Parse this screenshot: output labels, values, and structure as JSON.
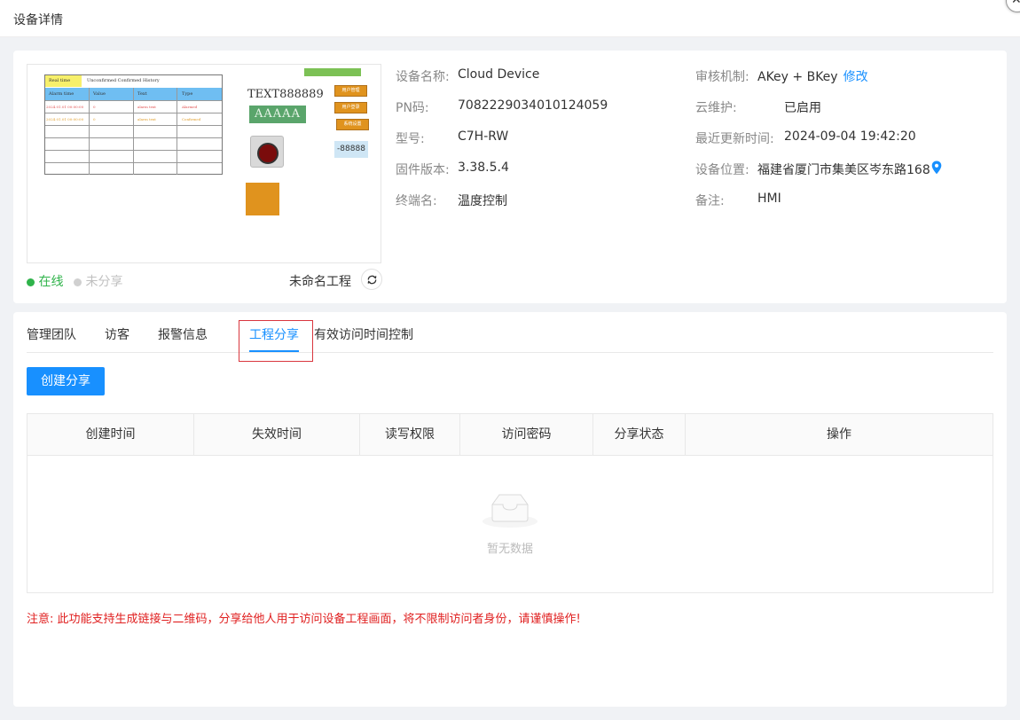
{
  "dialog": {
    "title": "设备详情",
    "close_symbol": "✕"
  },
  "preview": {
    "realtime_label": "Real time",
    "tab_labels": "Unconfirmed  Confirmed  History",
    "table_headers": [
      "Alarm time",
      "Value",
      "Text",
      "Type"
    ],
    "rows": [
      [
        "2024.01.01 00:00:00",
        "0",
        "alarm text",
        "Alarmed"
      ],
      [
        "2024.01.01 00:00:00",
        "0",
        "alarm text",
        "Confirmed"
      ]
    ],
    "text_label": "TEXT888889",
    "aaaaa_label": "AAAAA",
    "orange_buttons": [
      "用户管理",
      "用户登录",
      "系统设置"
    ],
    "number_display": "-88888"
  },
  "status": {
    "online": "在线",
    "unshared": "未分享",
    "project_name": "未命名工程"
  },
  "info_left": [
    {
      "label": "设备名称:",
      "value": "Cloud Device"
    },
    {
      "label": "PN码:",
      "value": "7082229034010124059"
    },
    {
      "label": "型号:",
      "value": "C7H-RW"
    },
    {
      "label": "固件版本:",
      "value": "3.38.5.4"
    },
    {
      "label": "终端名:",
      "value": "温度控制"
    }
  ],
  "info_right": [
    {
      "label": "审核机制:",
      "value": "AKey + BKey",
      "link": "修改"
    },
    {
      "label": "云维护:",
      "value": "已启用"
    },
    {
      "label": "最近更新时间:",
      "value": "2024-09-04 19:42:20"
    },
    {
      "label": "设备位置:",
      "value": "福建省厦门市集美区岑东路168"
    },
    {
      "label": "备注:",
      "value": "HMI"
    }
  ],
  "tabs": [
    "管理团队",
    "访客",
    "报警信息",
    "工程分享",
    "有效访问时间控制"
  ],
  "active_tab": "工程分享",
  "create_button": "创建分享",
  "table": {
    "headers": [
      "创建时间",
      "失效时间",
      "读写权限",
      "访问密码",
      "分享状态",
      "操作"
    ],
    "empty_text": "暂无数据"
  },
  "notice": "注意: 此功能支持生成链接与二维码，分享给他人用于访问设备工程画面，将不限制访问者身份，请谨慎操作!",
  "colors": {
    "primary": "#1890ff",
    "online": "#2fb34a",
    "warning": "#e02020"
  }
}
